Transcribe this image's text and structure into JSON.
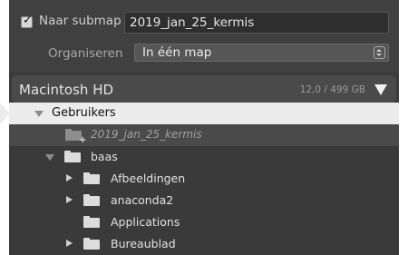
{
  "subfolder": {
    "checked": true,
    "label": "Naar submap",
    "value": "2019_jan_25_kermis",
    "check_glyph": "✓"
  },
  "organize": {
    "label": "Organiseren",
    "selected": "In één map"
  },
  "volume": {
    "name": "Macintosh HD",
    "size": "12,0 / 499 GB"
  },
  "tree": {
    "gebruikers": "Gebruikers",
    "destination": "2019_jan_25_kermis",
    "destination_plus": "+",
    "baas": "baas",
    "children": [
      {
        "label": "Afbeeldingen"
      },
      {
        "label": "anaconda2"
      },
      {
        "label": "Applications"
      },
      {
        "label": "Bureaublad"
      }
    ]
  },
  "colors": {
    "panel": "#3a3a3a",
    "selection": "#ececec"
  }
}
